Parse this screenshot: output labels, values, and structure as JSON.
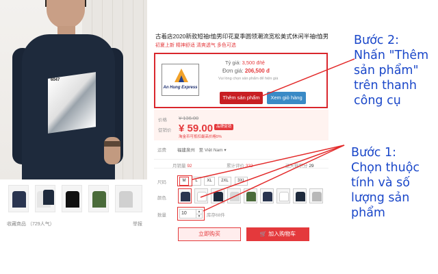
{
  "product": {
    "title": "古着店2020新款短袖t恤男印花夏季圆领潮流宽松美式休闲半袖t恤男",
    "subtitle": "初夏上新 精神舒适 清爽透气 多色可选",
    "print_text": "6047",
    "favorites": "收藏商品  （729人气）",
    "report": "举报"
  },
  "popup": {
    "logo_text": "An Hung Express",
    "rate_label": "Tỷ giá:",
    "rate_value": "3,500 đ/tệ",
    "price_label": "Đơn giá:",
    "price_value": "206,500 đ",
    "hint": "Vui lòng chọn sản phẩm để hiện giá",
    "add_button": "Thêm sản phẩm",
    "cart_button": "Xem giỏ hàng"
  },
  "pricing": {
    "price_label": "价格",
    "old_price": "¥ 136.00",
    "promo_label": "促销价",
    "new_price": "¥ 59.00",
    "promo_badge": "品牌促销",
    "promo_note": "淘金币可抵扣最高价格5%"
  },
  "shipping": {
    "label": "运费",
    "from": "福建泉州",
    "to": "至 Việt Nam",
    "to_arrow": "▾"
  },
  "stats": {
    "monthly": "月销量",
    "monthly_value": "92",
    "reviews": "累计评价",
    "reviews_value": "322",
    "points": "送天猫积分",
    "points_value": "29"
  },
  "options": {
    "size_label": "尺码",
    "sizes": [
      "M",
      "L",
      "XL",
      "2XL",
      "3XL"
    ],
    "selected_size": "M",
    "color_label": "颜色",
    "quantity_label": "数量",
    "quantity": "10",
    "stock": "库存68件"
  },
  "actions": {
    "buy_now": "立即购买",
    "add_to_cart": "加入购物车",
    "cart_icon": "🛒"
  },
  "annotations": {
    "step2": [
      "Bước 2:",
      "Nhấn \"Thêm",
      "sản phẩm\"",
      "trên thanh",
      "công cụ"
    ],
    "step1": [
      "Bước 1:",
      "Chọn thuộc",
      "tính và số",
      "lượng sản",
      "phẩm"
    ]
  },
  "colors": {
    "accent_red": "#e4393c",
    "annotation_blue": "#1a47c9",
    "popup_add": "#c81e23",
    "popup_cart": "#3a8ac6",
    "swatches": [
      "#2a3550",
      "#ffffff",
      "#1e2a3c",
      "#d8d8d8",
      "#4a6b3a",
      "#2a3550",
      "#ffffff",
      "#1e2a3c",
      "#b8b8b8"
    ]
  }
}
